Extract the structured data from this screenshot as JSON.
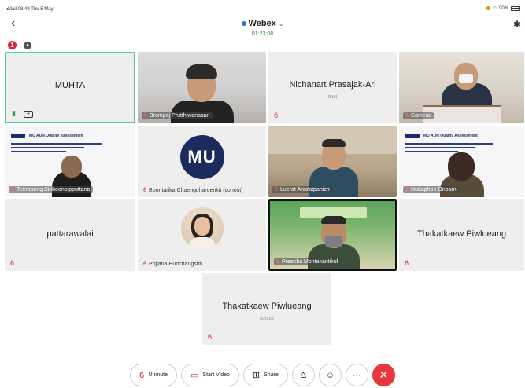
{
  "status_bar": {
    "left": "◂Mail  08:49  Thu 5 May",
    "battery": "90%"
  },
  "header": {
    "title": "Webex",
    "timer": "01:23:08"
  },
  "indicators": {
    "alert_count": "1"
  },
  "tiles": [
    {
      "name": "MUHTA"
    },
    {
      "name": "Brompoj Prutthiwanasan"
    },
    {
      "name": "Nichanart Prasajak-Ari",
      "subtitle": "host"
    },
    {
      "name": "Camera"
    },
    {
      "name": "Teerapong Siriboonpipputtana"
    },
    {
      "name": "Boontarika Chaengcharoenkit (cohost)"
    },
    {
      "name": "Luerat Anuratpanich"
    },
    {
      "name": "Nuttaphon Onparn"
    },
    {
      "name": "pattarawalai"
    },
    {
      "name": "Pojjana Hunchangsith"
    },
    {
      "name": "Preecha Montakantikul"
    },
    {
      "name": "Thakatkaew Piwlueang"
    },
    {
      "name": "Thakatkaew Piwlueang",
      "subtitle": "cohost"
    }
  ],
  "slide": {
    "title": "MU AUN Quality Assessment"
  },
  "logo_text": "MU",
  "toolbar": {
    "unmute": "Unmute",
    "start_video": "Start Video",
    "share": "Share"
  },
  "colors": {
    "active_border": "#58c5ad",
    "mute_red": "#d9263a",
    "end_call": "#e8383f",
    "accent_blue": "#1b73e8"
  }
}
